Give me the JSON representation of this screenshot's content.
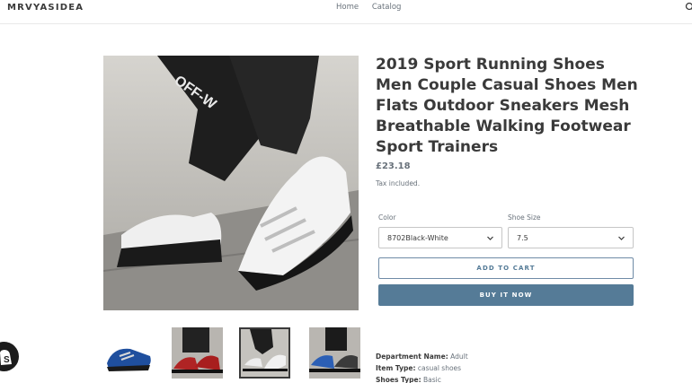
{
  "header": {
    "logo": "MRVYASIDEA",
    "nav": [
      "Home",
      "Catalog"
    ],
    "search_icon": "search-icon"
  },
  "product": {
    "title": "2019 Sport Running Shoes Men Couple Casual Shoes Men Flats Outdoor Sneakers Mesh Breathable Walking Footwear Sport Trainers",
    "price": "£23.18",
    "tax_note": "Tax included.",
    "color_label": "Color",
    "color_value": "8702Black-White",
    "size_label": "Shoe Size",
    "size_value": "7.5",
    "add_to_cart": "ADD TO CART",
    "buy_now": "BUY IT NOW",
    "specs": [
      {
        "name": "Department Name:",
        "value": "Adult"
      },
      {
        "name": "Item Type:",
        "value": "casual shoes"
      },
      {
        "name": "Shoes Type:",
        "value": "Basic"
      }
    ],
    "thumb_count": 4,
    "active_thumb": 3
  },
  "colors": {
    "accent": "#557b97",
    "text": "#3a3a3a",
    "muted": "#69727b"
  },
  "badge": "shopify-icon"
}
